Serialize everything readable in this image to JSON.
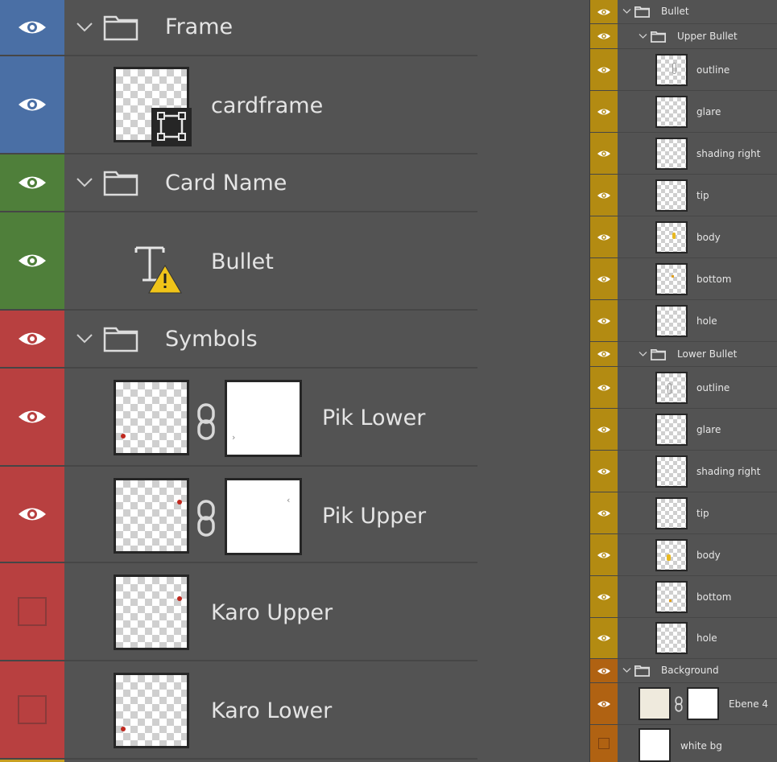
{
  "colors": {
    "blue": "#4a6fa5",
    "green": "#4f7f3a",
    "red": "#b84040",
    "gold": "#b38b12",
    "orange": "#b06212",
    "panel_bg": "#535353",
    "text": "#e4e4e4"
  },
  "left": {
    "frame_group": "Frame",
    "cardframe": "cardframe",
    "card_name_group": "Card Name",
    "bullet_text_layer": "Bullet",
    "symbols_group": "Symbols",
    "pik_lower": "Pik Lower",
    "pik_upper": "Pik Upper",
    "karo_upper": "Karo Upper",
    "karo_lower": "Karo Lower"
  },
  "right": {
    "bullet_group": "Bullet",
    "upper_bullet_group": "Upper Bullet",
    "upper_layers": [
      "outline",
      "glare",
      "shading right",
      "tip",
      "body",
      "bottom",
      "hole"
    ],
    "lower_bullet_group": "Lower Bullet",
    "lower_layers": [
      "outline",
      "glare",
      "shading right",
      "tip",
      "body",
      "bottom",
      "hole"
    ],
    "background_group": "Background",
    "ebene4": "Ebene 4",
    "white_bg": "white bg"
  },
  "icons": {
    "visibility": "eye-icon",
    "group": "folder-icon",
    "expand": "chevron-down-icon",
    "text_layer": "text-layer-warning-icon",
    "link": "chain-link-icon",
    "smart_object": "smart-object-icon"
  }
}
